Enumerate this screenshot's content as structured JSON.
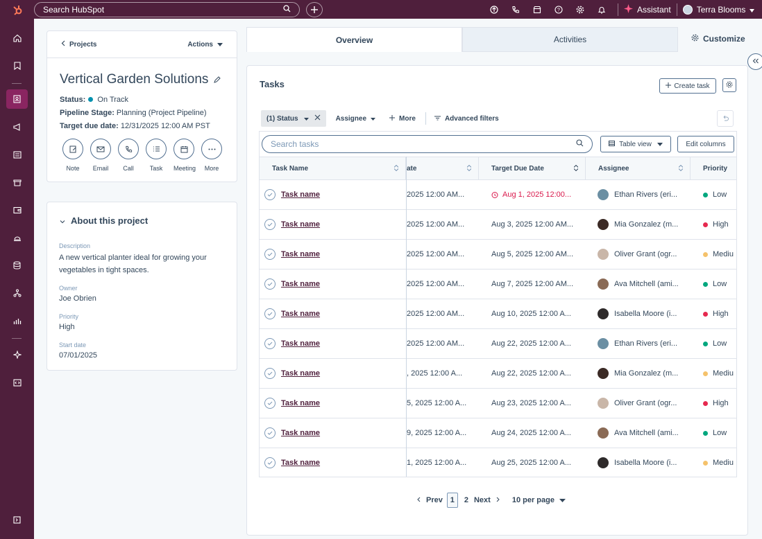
{
  "topbar": {
    "search_placeholder": "Search HubSpot",
    "assistant_label": "Assistant",
    "user_name": "Terra Blooms"
  },
  "left": {
    "breadcrumb": "Projects",
    "actions_label": "Actions",
    "title": "Vertical Garden Solutions",
    "status_label": "Status:",
    "status_value": "On Track",
    "pipeline_label": "Pipeline Stage:",
    "pipeline_value": "Planning (Project Pipeline)",
    "due_label": "Target due date:",
    "due_value": "12/31/2025 12:00 AM PST",
    "quick_actions": [
      "Note",
      "Email",
      "Call",
      "Task",
      "Meeting",
      "More"
    ]
  },
  "about": {
    "heading": "About this project",
    "description_label": "Description",
    "description_value": "A new vertical planter ideal for growing your vegetables in tight spaces.",
    "owner_label": "Owner",
    "owner_value": "Joe Obrien",
    "priority_label": "Priority",
    "priority_value": "High",
    "start_label": "Start date",
    "start_value": "07/01/2025"
  },
  "tabs": {
    "overview": "Overview",
    "activities": "Activities",
    "customize": "Customize"
  },
  "tasks": {
    "heading": "Tasks",
    "create_label": "Create task",
    "filter_status": "(1) Status",
    "filter_assignee": "Assignee",
    "filter_more": "More",
    "advanced": "Advanced filters",
    "search_placeholder": "Search tasks",
    "table_view": "Table view",
    "edit_columns": "Edit columns",
    "headers": [
      "Task Name",
      "ate",
      "Target Due Date",
      "Assignee",
      "Priority"
    ],
    "rows": [
      {
        "name": "Task name",
        "date": "2025 12:00 AM...",
        "due": "Aug 1, 2025 12:00...",
        "overdue": true,
        "assignee": "Ethan Rivers (eri...",
        "priority": "Low"
      },
      {
        "name": "Task name",
        "date": "2025 12:00 AM...",
        "due": "Aug 3, 2025 12:00 AM...",
        "overdue": false,
        "assignee": "Mia Gonzalez (m...",
        "priority": "High"
      },
      {
        "name": "Task name",
        "date": "2025 12:00 AM...",
        "due": "Aug 5, 2025 12:00 AM...",
        "overdue": false,
        "assignee": "Oliver Grant (ogr...",
        "priority": "Mediu"
      },
      {
        "name": "Task name",
        "date": "2025 12:00 AM...",
        "due": "Aug 7, 2025 12:00 AM...",
        "overdue": false,
        "assignee": "Ava Mitchell (ami...",
        "priority": "Low"
      },
      {
        "name": "Task name",
        "date": "2025 12:00 AM...",
        "due": "Aug 10, 2025 12:00 A...",
        "overdue": false,
        "assignee": "Isabella Moore (i...",
        "priority": "High"
      },
      {
        "name": "Task name",
        "date": "2025 12:00 AM...",
        "due": "Aug 22, 2025 12:00 A...",
        "overdue": false,
        "assignee": "Ethan Rivers (eri...",
        "priority": "Low"
      },
      {
        "name": "Task name",
        "date": ", 2025 12:00 A...",
        "due": "Aug 22, 2025 12:00 A...",
        "overdue": false,
        "assignee": "Mia Gonzalez (m...",
        "priority": "Mediu"
      },
      {
        "name": "Task name",
        "date": "5, 2025 12:00 A...",
        "due": "Aug 23, 2025 12:00 A...",
        "overdue": false,
        "assignee": "Oliver Grant (ogr...",
        "priority": "High"
      },
      {
        "name": "Task name",
        "date": "9, 2025 12:00 A...",
        "due": "Aug 24, 2025 12:00 A...",
        "overdue": false,
        "assignee": "Ava Mitchell (ami...",
        "priority": "Low"
      },
      {
        "name": "Task name",
        "date": "1, 2025 12:00 A...",
        "due": "Aug 25, 2025 12:00 A...",
        "overdue": false,
        "assignee": "Isabella Moore (i...",
        "priority": "Mediu"
      }
    ],
    "pager": {
      "prev": "Prev",
      "current": "1",
      "page2": "2",
      "next": "Next",
      "per_page": "10 per page"
    }
  },
  "colors": {
    "low": "#00a77e",
    "high": "#e6294f",
    "medium": "#f5c26b",
    "overdue": "#d9184b",
    "brand": "#4f1f3c"
  }
}
